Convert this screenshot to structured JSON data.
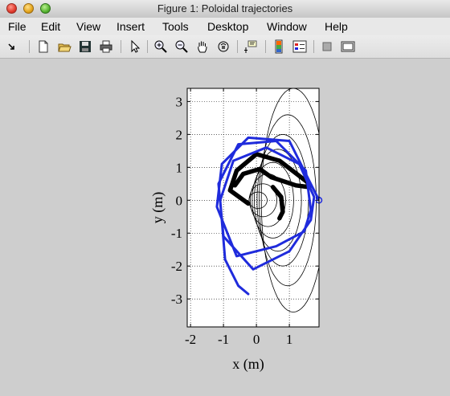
{
  "window": {
    "title": "Figure 1: Poloidal trajectories"
  },
  "menu": [
    "File",
    "Edit",
    "View",
    "Insert",
    "Tools",
    "Desktop",
    "Window",
    "Help"
  ],
  "toolbar": [
    {
      "name": "rotate-arrow-icon"
    },
    {
      "name": "new-figure-icon"
    },
    {
      "name": "open-file-icon"
    },
    {
      "name": "save-icon"
    },
    {
      "name": "print-icon"
    },
    {
      "name": "edit-plot-pointer-icon"
    },
    {
      "name": "zoom-in-icon"
    },
    {
      "name": "zoom-out-icon"
    },
    {
      "name": "pan-hand-icon"
    },
    {
      "name": "rotate-3d-icon"
    },
    {
      "name": "data-cursor-icon"
    },
    {
      "name": "colorbar-icon"
    },
    {
      "name": "legend-icon"
    },
    {
      "name": "hide-plot-tools-icon"
    },
    {
      "name": "show-plot-tools-icon"
    }
  ],
  "chart_data": {
    "type": "line",
    "xlabel": "x (m)",
    "ylabel": "y (m)",
    "xlim": [
      -2.1,
      1.9
    ],
    "ylim": [
      -3.85,
      3.4
    ],
    "xticks": [
      -2,
      -1,
      0,
      1
    ],
    "yticks": [
      -3,
      -2,
      -1,
      0,
      1,
      2,
      3
    ],
    "grid": true,
    "series": [
      {
        "color": "#000000",
        "style": "thin-contour",
        "values": [
          [
            0.05,
            0.25,
            0.32
          ],
          [
            0.2,
            0.5,
            0.6
          ],
          [
            0.35,
            0.8,
            0.85
          ],
          [
            0.5,
            1.15,
            1.08
          ],
          [
            0.65,
            1.55,
            1.3
          ],
          [
            0.8,
            2.0,
            1.5
          ],
          [
            0.95,
            2.6,
            1.72
          ],
          [
            1.12,
            3.4,
            1.98
          ]
        ]
      },
      {
        "color": "#000000",
        "style": "thick-orbit",
        "values": [
          [
            -0.25,
            -0.1
          ],
          [
            -0.8,
            0.3
          ],
          [
            -0.6,
            0.9
          ],
          [
            0.0,
            1.4
          ],
          [
            0.7,
            1.2
          ],
          [
            1.55,
            0.55
          ],
          [
            1.6,
            0.4
          ],
          [
            1.2,
            0.45
          ],
          [
            0.45,
            0.7
          ],
          [
            0.1,
            0.95
          ],
          [
            -0.4,
            0.8
          ],
          [
            -0.65,
            0.45
          ]
        ]
      },
      {
        "color": "#000000",
        "style": "thick-orbit",
        "values": [
          [
            0.5,
            0.4
          ],
          [
            0.75,
            0.1
          ],
          [
            0.8,
            -0.35
          ],
          [
            0.7,
            -0.55
          ]
        ]
      },
      {
        "color": "#1f2bdc",
        "style": "trajectory",
        "values": [
          [
            1.9,
            0.0
          ],
          [
            1.0,
            1.8
          ],
          [
            -0.25,
            1.9
          ],
          [
            -1.05,
            1.1
          ],
          [
            -1.2,
            -0.2
          ],
          [
            -0.6,
            -1.7
          ],
          [
            0.6,
            -1.4
          ],
          [
            1.45,
            -0.95
          ],
          [
            1.65,
            -0.3
          ],
          [
            1.5,
            0.9
          ],
          [
            0.6,
            1.8
          ],
          [
            -0.55,
            1.7
          ],
          [
            -1.15,
            0.5
          ],
          [
            -1.0,
            -1.1
          ],
          [
            -0.1,
            -2.1
          ],
          [
            1.0,
            -1.55
          ],
          [
            1.65,
            -0.6
          ],
          [
            1.75,
            0.1
          ],
          [
            1.3,
            1.1
          ],
          [
            0.3,
            1.6
          ],
          [
            -0.7,
            1.2
          ],
          [
            -1.1,
            0.0
          ],
          [
            -0.95,
            -1.8
          ],
          [
            -0.55,
            -2.6
          ],
          [
            -0.25,
            -2.85
          ]
        ]
      }
    ],
    "marker": {
      "x": 1.9,
      "y": 0.0,
      "color": "#1f2bdc"
    }
  }
}
